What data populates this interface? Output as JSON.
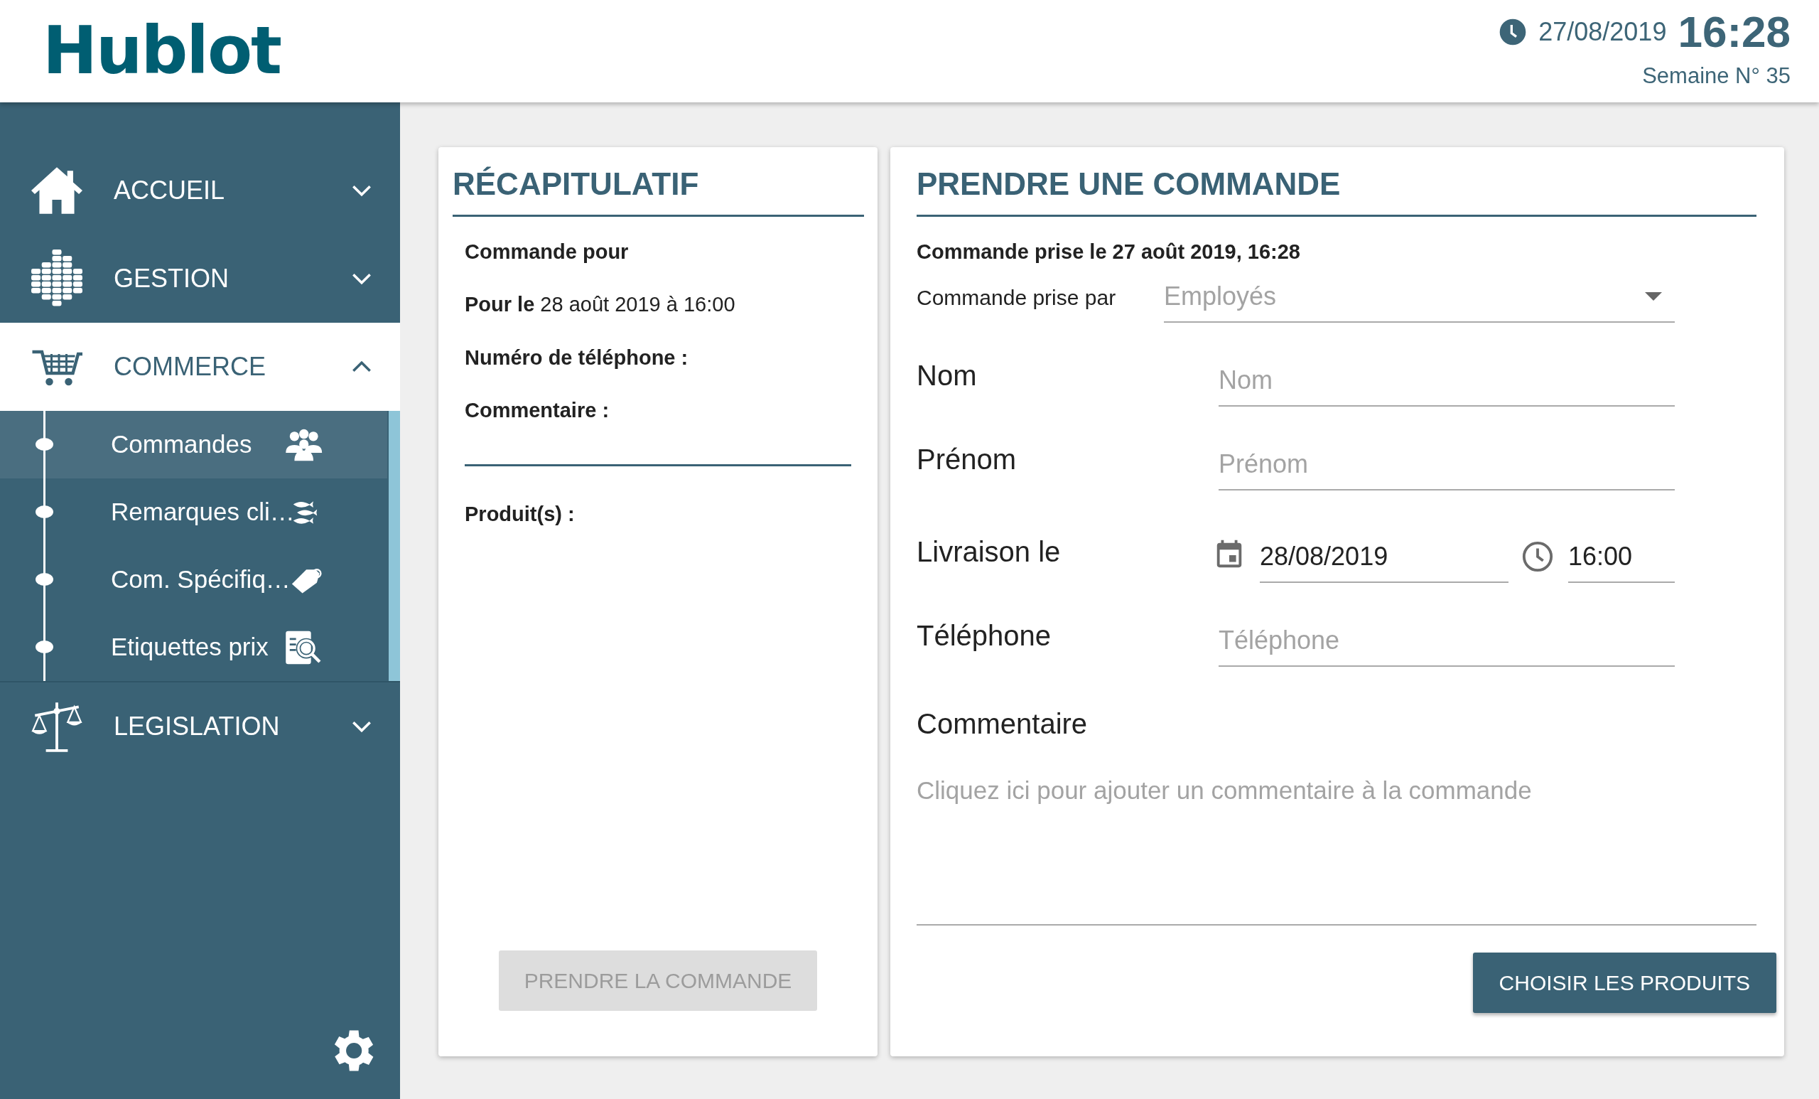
{
  "header": {
    "logo": "Hublot",
    "date": "27/08/2019",
    "time": "16:28",
    "week": "Semaine N° 35"
  },
  "sidebar": {
    "items": [
      {
        "label": "ACCUEIL",
        "expanded": false
      },
      {
        "label": "GESTION",
        "expanded": false
      },
      {
        "label": "COMMERCE",
        "expanded": true,
        "children": [
          {
            "label": "Commandes",
            "selected": true
          },
          {
            "label": "Remarques cli…",
            "selected": false
          },
          {
            "label": "Com. Spécifiq…",
            "selected": false
          },
          {
            "label": "Etiquettes prix",
            "selected": false
          }
        ]
      },
      {
        "label": "LEGISLATION",
        "expanded": false
      }
    ]
  },
  "summary": {
    "title": "RÉCAPITULATIF",
    "lines": [
      {
        "label": "Commande pour"
      },
      {
        "label": "Pour le",
        "value": "28 août 2019 à 16:00"
      },
      {
        "label": "Numéro de téléphone :"
      },
      {
        "label": "Commentaire :"
      }
    ],
    "products_label": "Produit(s) :",
    "submit_button": {
      "label": "PRENDRE LA COMMANDE",
      "disabled": true
    }
  },
  "order": {
    "title": "PRENDRE UNE COMMANDE",
    "taken_at": "Commande prise le 27 août 2019, 16:28",
    "taken_by": {
      "label": "Commande prise par",
      "placeholder": "Employés"
    },
    "fields": [
      {
        "kind": "text",
        "label": "Nom",
        "placeholder": "Nom"
      },
      {
        "kind": "text",
        "label": "Prénom",
        "placeholder": "Prénom"
      },
      {
        "kind": "datetime",
        "label": "Livraison le",
        "date": "28/08/2019",
        "time": "16:00"
      },
      {
        "kind": "text",
        "label": "Téléphone",
        "placeholder": "Téléphone"
      }
    ],
    "comment": {
      "label": "Commentaire",
      "placeholder": "Cliquez ici pour ajouter un commentaire à la commande"
    },
    "next_button": {
      "label": "CHOISIR LES PRODUITS",
      "disabled": false
    }
  }
}
